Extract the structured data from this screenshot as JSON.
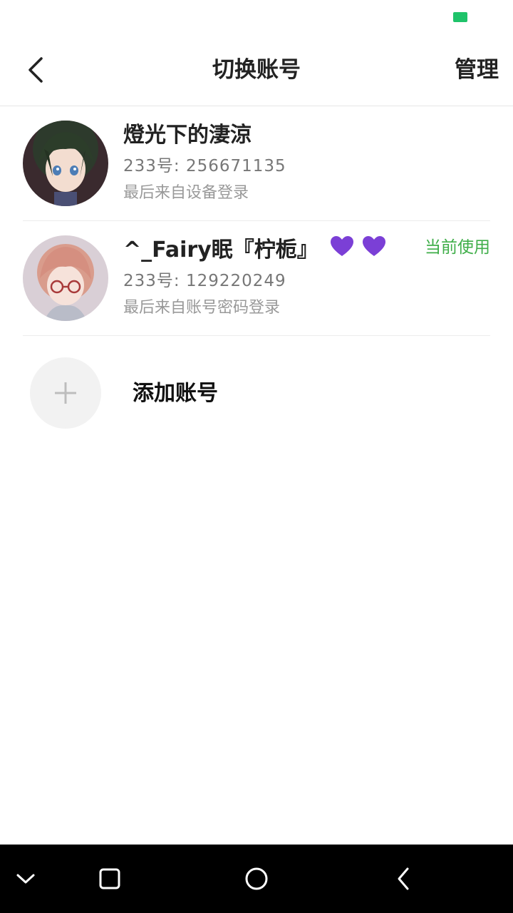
{
  "status_bar": {
    "battery_color": "#1fc36a"
  },
  "header": {
    "back_icon": "chevron-left-icon",
    "title": "切换账号",
    "manage_label": "管理"
  },
  "accounts": [
    {
      "name": "燈光下的淒涼",
      "uid": "233号: 256671135",
      "login_method": "最后来自设备登录",
      "current_label": ""
    },
    {
      "name": "^_Fairy眠『柠栀』",
      "name_badge_icons": [
        "purple-heart-icon",
        "purple-heart-icon"
      ],
      "uid": "233号: 129220249",
      "login_method": "最后来自账号密码登录",
      "current_label": "当前使用"
    }
  ],
  "add_account": {
    "icon": "plus-icon",
    "label": "添加账号"
  },
  "system_nav": {
    "buttons": [
      "collapse-icon",
      "recents-icon",
      "home-icon",
      "back-icon"
    ]
  },
  "colors": {
    "accent_green": "#3fae49",
    "heart_purple": "#7b3fd6",
    "secondary_text": "#777777"
  }
}
